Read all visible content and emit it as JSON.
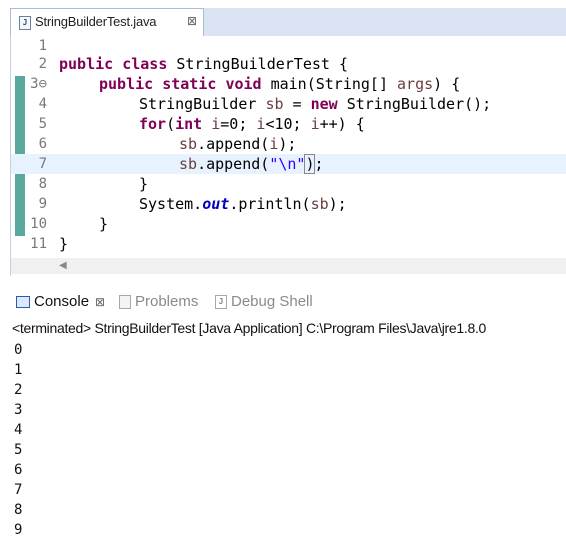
{
  "editor": {
    "tab_title": "StringBuilderTest.java",
    "tab_close_glyph": "⊠",
    "file_icon_glyph": "J",
    "lines": [
      {
        "num": "1"
      },
      {
        "num": "2"
      },
      {
        "num": "3⊖"
      },
      {
        "num": "4"
      },
      {
        "num": "5"
      },
      {
        "num": "6"
      },
      {
        "num": "7"
      },
      {
        "num": "8"
      },
      {
        "num": "9"
      },
      {
        "num": "10"
      },
      {
        "num": "11"
      }
    ],
    "code": {
      "l2_kw1": "public",
      "l2_kw2": "class",
      "l2_rest": " StringBuilderTest {",
      "l3_kw1": "public",
      "l3_kw2": "static",
      "l3_kw3": "void",
      "l3_rest1": " main(String[] ",
      "l3_args": "args",
      "l3_rest2": ") {",
      "l4_rest1": "StringBuilder ",
      "l4_var": "sb",
      "l4_rest2": " = ",
      "l4_kw": "new",
      "l4_rest3": " StringBuilder();",
      "l5_kw1": "for",
      "l5_p1": "(",
      "l5_kw2": "int",
      "l5_i1": "i",
      "l5_r1": "=0; ",
      "l5_i2": "i",
      "l5_r2": "<10; ",
      "l5_i3": "i",
      "l5_r3": "++) {",
      "l6_sb": "sb",
      "l6_r1": ".append(",
      "l6_i": "i",
      "l6_r2": ");",
      "l7_sb": "sb",
      "l7_r1": ".append(",
      "l7_str": "\"\\n\"",
      "l7_close": ")",
      "l7_end": ";",
      "l8": "}",
      "l9_r1": "System.",
      "l9_field": "out",
      "l9_r2": ".println(",
      "l9_sb": "sb",
      "l9_r3": ");",
      "l10": "}",
      "l11": "}"
    },
    "hscroll_arrow": "◀"
  },
  "views": {
    "console_label": "Console",
    "console_close_glyph": "⊠",
    "problems_label": "Problems",
    "debug_label": "Debug Shell",
    "debug_icon_glyph": "J",
    "status": "<terminated> StringBuilderTest [Java Application] C:\\Program Files\\Java\\jre1.8.0"
  },
  "console_output": [
    "0",
    "1",
    "2",
    "3",
    "4",
    "5",
    "6",
    "7",
    "8",
    "9"
  ],
  "colors": {
    "keyword": "#7f0055",
    "variable": "#6a3e3e",
    "string": "#2a00ff",
    "field": "#0000c0",
    "current_line": "#e8f2fe",
    "ruler_mark": "#5aa99e",
    "tab_strip": "#dbe4f2"
  }
}
